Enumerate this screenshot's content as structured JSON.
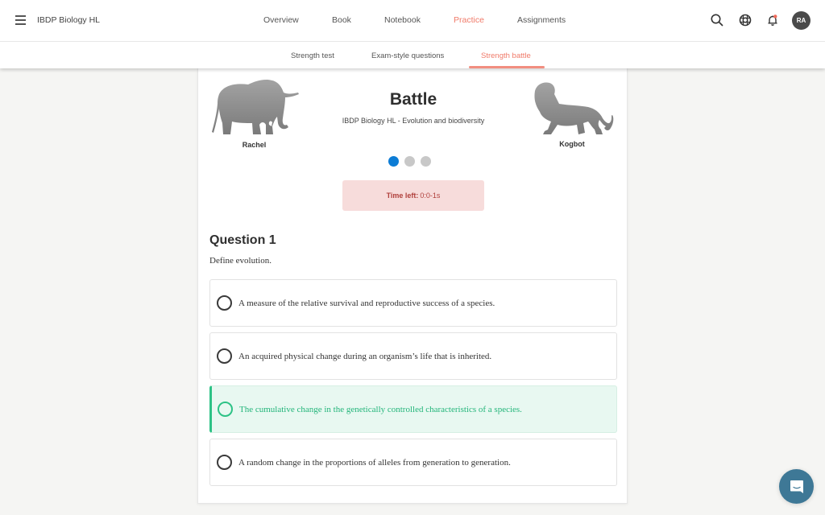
{
  "app": {
    "title": "IBDP Biology HL"
  },
  "main_nav": {
    "items": [
      {
        "label": "Overview",
        "active": false
      },
      {
        "label": "Book",
        "active": false
      },
      {
        "label": "Notebook",
        "active": false
      },
      {
        "label": "Practice",
        "active": true
      },
      {
        "label": "Assignments",
        "active": false
      }
    ]
  },
  "top_icons": {
    "search": "search-icon",
    "help": "lifebuoy-icon",
    "notifications": "bell-icon",
    "avatar_initials": "RA"
  },
  "sub_nav": {
    "items": [
      {
        "label": "Strength test",
        "active": false
      },
      {
        "label": "Exam-style questions",
        "active": false
      },
      {
        "label": "Strength battle",
        "active": true
      }
    ]
  },
  "battle": {
    "title": "Battle",
    "subtitle": "IBDP Biology HL - Evolution and biodiversity",
    "player_left": {
      "name": "Rachel",
      "avatar": "elephant"
    },
    "player_right": {
      "name": "Kogbot",
      "avatar": "lion"
    },
    "progress": {
      "total": 3,
      "current": 1
    },
    "timer": {
      "label": "Time left:",
      "value": "0:0-1s"
    }
  },
  "question": {
    "title": "Question 1",
    "prompt": "Define evolution.",
    "options": [
      {
        "text": "A measure of the relative survival and reproductive success of a species.",
        "state": "default"
      },
      {
        "text": "An acquired physical change during an organism’s life that is inherited.",
        "state": "default"
      },
      {
        "text": "The cumulative change in the genetically controlled characteristics of a species.",
        "state": "correct"
      },
      {
        "text": "A random change in the proportions of alleles from generation to generation.",
        "state": "default"
      }
    ]
  },
  "colors": {
    "accent": "#f07a69",
    "progress_active": "#0c7cd5",
    "correct": "#2dc286",
    "timer_bg": "#f7dcdb",
    "timer_text": "#b0403c",
    "chat": "#3e7896"
  },
  "chat": {
    "icon": "chat-icon"
  }
}
